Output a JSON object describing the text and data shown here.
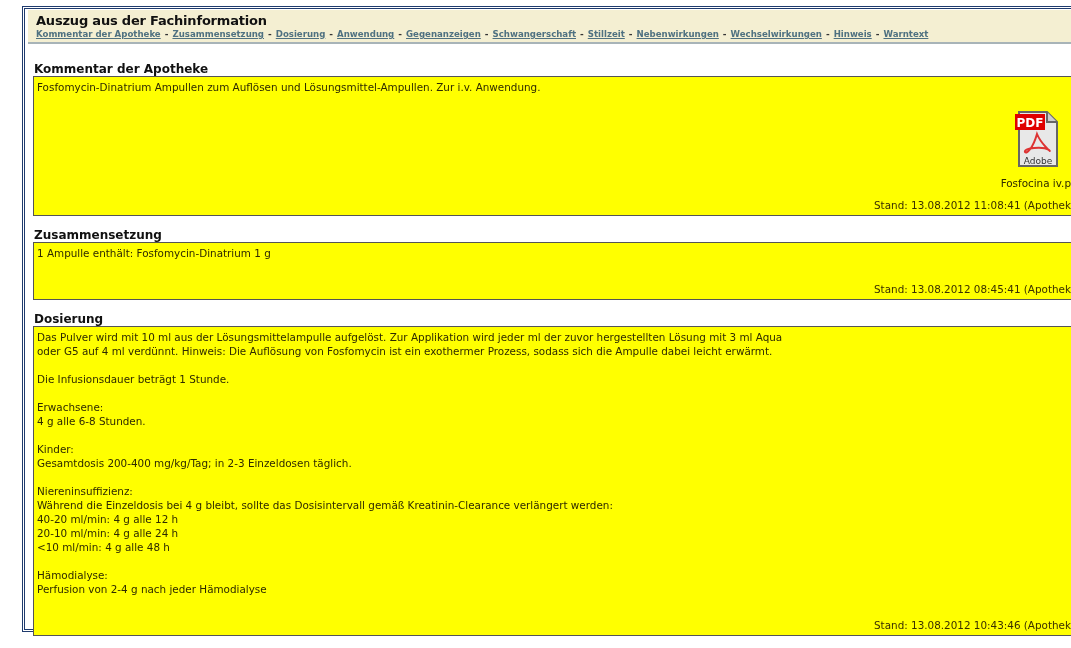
{
  "title": "Auszug aus der Fachinformation",
  "nav_links": [
    "Kommentar der Apotheke",
    "Zusammensetzung",
    "Dosierung",
    "Anwendung",
    "Gegenanzeigen",
    "Schwangerschaft",
    "Stillzeit",
    "Nebenwirkungen",
    "Wechselwirkungen",
    "Hinweis",
    "Warntext"
  ],
  "nav_separator": "-",
  "sections": [
    {
      "heading": "Kommentar der Apotheke",
      "paragraphs": [
        [
          "Fosfomycin-Dinatrium Ampullen zum Auflösen und Lösungsmittel-Ampullen. Zur i.v. Anwendung."
        ]
      ],
      "attachment": {
        "filename": "Fosfocina iv.p",
        "icon_label": "PDF",
        "icon_sublabel": "Adobe"
      },
      "stand": "Stand: 13.08.2012 11:08:41 (Apothek"
    },
    {
      "heading": "Zusammensetzung",
      "paragraphs": [
        [
          "1 Ampulle enthält: Fosfomycin-Dinatrium 1 g"
        ]
      ],
      "stand": "Stand: 13.08.2012 08:45:41 (Apothek"
    },
    {
      "heading": "Dosierung",
      "paragraphs": [
        [
          "Das Pulver wird mit 10 ml aus der Lösungsmittelampulle aufgelöst. Zur Applikation wird jeder ml der zuvor hergestellten Lösung mit 3 ml Aqua",
          "oder G5 auf 4 ml verdünnt. Hinweis: Die Auflösung von Fosfomycin ist ein exothermer Prozess, sodass sich die Ampulle dabei leicht erwärmt."
        ],
        [
          "Die Infusionsdauer beträgt 1 Stunde."
        ],
        [
          "Erwachsene:",
          "4 g alle 6-8 Stunden."
        ],
        [
          "Kinder:",
          "Gesamtdosis 200-400 mg/kg/Tag; in 2-3 Einzeldosen täglich."
        ],
        [
          "Niereninsuffizienz:",
          "Während die Einzeldosis bei 4 g bleibt, sollte das Dosisintervall gemäß Kreatinin-Clearance verlängert werden:",
          "40-20 ml/min: 4 g alle 12 h",
          "20-10 ml/min: 4 g alle 24 h",
          "<10 ml/min: 4 g alle 48 h"
        ],
        [
          "Hämodialyse:",
          "Perfusion von 2-4 g nach jeder Hämodialyse"
        ]
      ],
      "stand": "Stand: 13.08.2012 10:43:46 (Apothek"
    }
  ]
}
